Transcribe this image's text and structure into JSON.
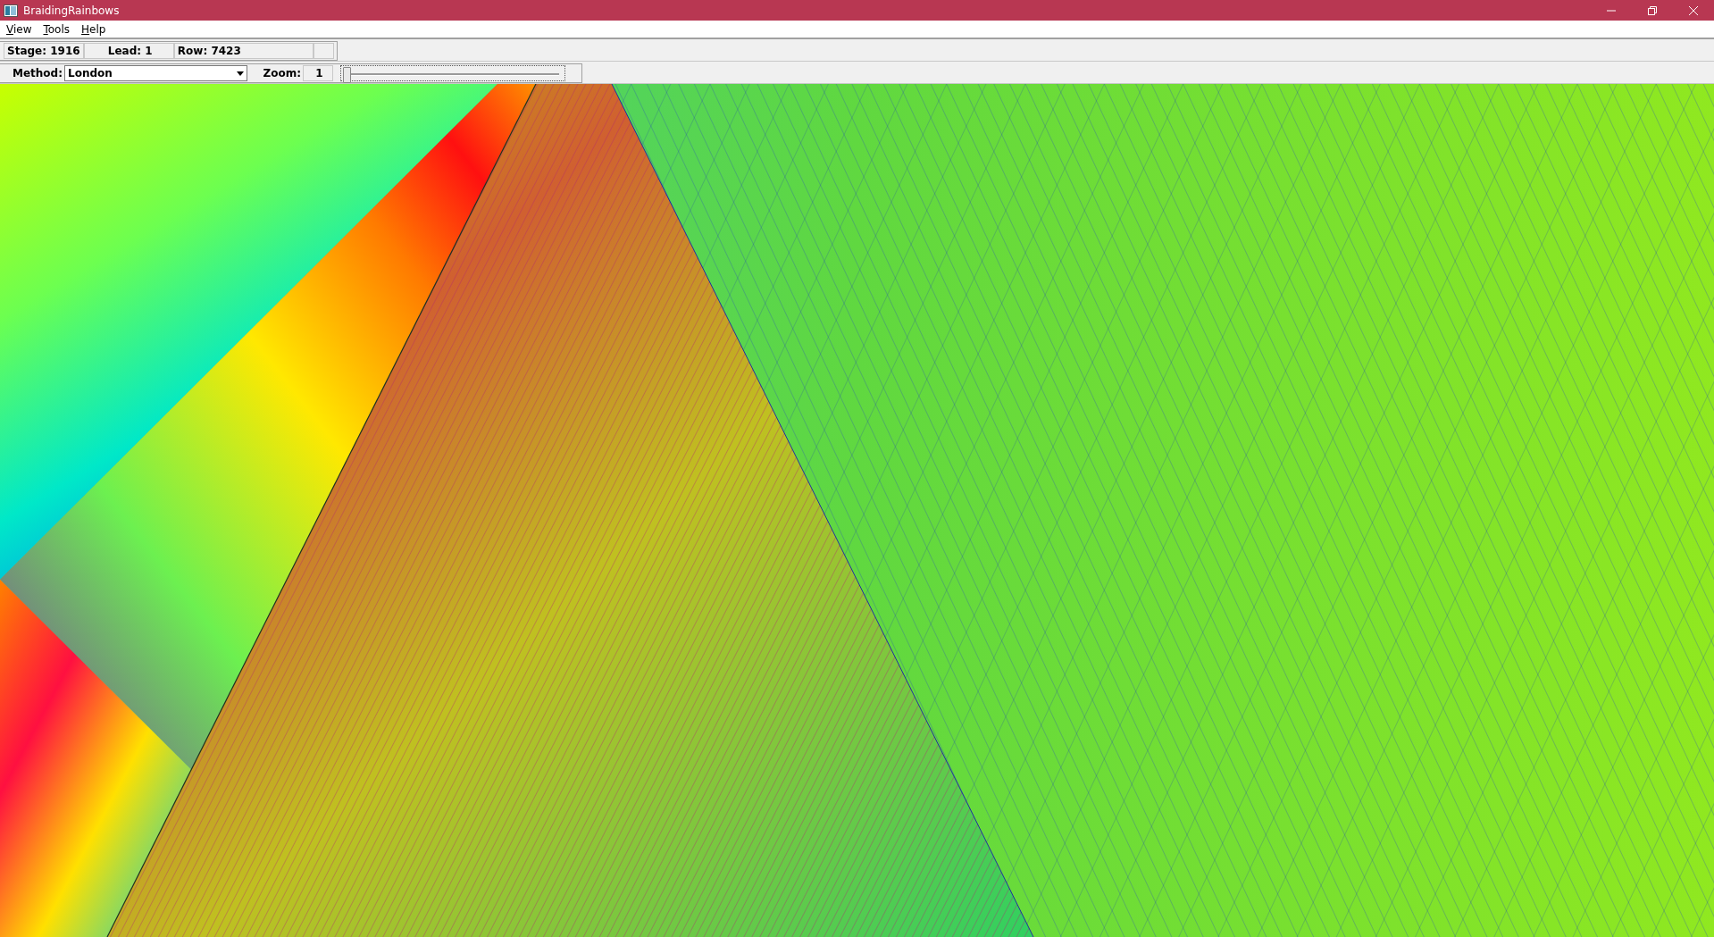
{
  "window": {
    "title": "BraidingRainbows"
  },
  "menu": [
    {
      "label": "View"
    },
    {
      "label": "Tools"
    },
    {
      "label": "Help"
    }
  ],
  "status": [
    {
      "text": "Stage: 1916"
    },
    {
      "text": "Lead: 1"
    },
    {
      "text": "Row: 7423"
    }
  ],
  "method": {
    "label": "Method:",
    "value": "London"
  },
  "zoom": {
    "label": "Zoom:",
    "value": "1",
    "level": 0
  }
}
